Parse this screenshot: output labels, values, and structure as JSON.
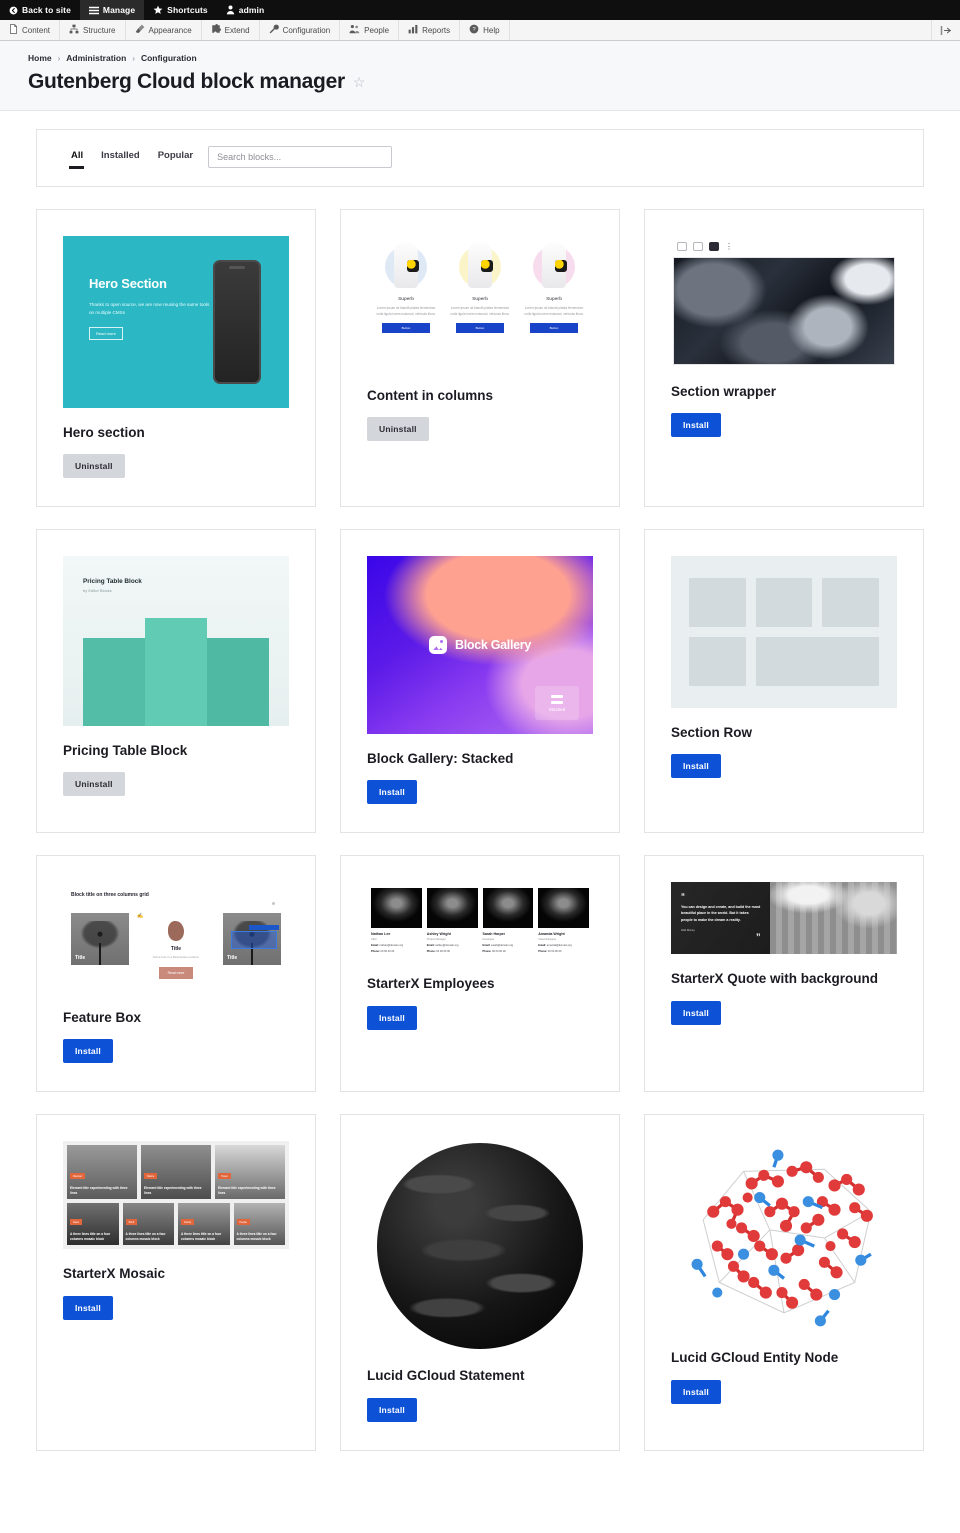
{
  "toolbar": {
    "back_to_site": "Back to site",
    "manage": "Manage",
    "shortcuts": "Shortcuts",
    "user": "admin",
    "menu": [
      {
        "label": "Content",
        "icon": "file-icon"
      },
      {
        "label": "Structure",
        "icon": "structure-icon"
      },
      {
        "label": "Appearance",
        "icon": "brush-icon"
      },
      {
        "label": "Extend",
        "icon": "puzzle-icon"
      },
      {
        "label": "Configuration",
        "icon": "wrench-icon"
      },
      {
        "label": "People",
        "icon": "people-icon"
      },
      {
        "label": "Reports",
        "icon": "bar-chart-icon"
      },
      {
        "label": "Help",
        "icon": "help-icon"
      }
    ]
  },
  "breadcrumb": {
    "items": [
      "Home",
      "Administration",
      "Configuration"
    ],
    "separator": "›"
  },
  "page": {
    "title": "Gutenberg Cloud block manager",
    "star": "☆"
  },
  "filter": {
    "tabs": [
      {
        "label": "All",
        "active": true
      },
      {
        "label": "Installed",
        "active": false
      },
      {
        "label": "Popular",
        "active": false
      }
    ],
    "search_placeholder": "Search blocks...",
    "search_value": ""
  },
  "colors": {
    "install_blue": "#0d52d6",
    "uninstall_gray": "#d3d6da",
    "page_bg": "#ffffff",
    "header_bg": "#f7f8fa",
    "toolbar_black": "#0f0f0f"
  },
  "cards": [
    {
      "title": "Hero section",
      "action": "Uninstall",
      "action_type": "uninstall",
      "thumb": "hero"
    },
    {
      "title": "Content in columns",
      "action": "Uninstall",
      "action_type": "uninstall",
      "thumb": "columns"
    },
    {
      "title": "Section wrapper",
      "action": "Install",
      "action_type": "install",
      "thumb": "wrapper"
    },
    {
      "title": "Pricing Table Block",
      "action": "Uninstall",
      "action_type": "uninstall",
      "thumb": "pricing"
    },
    {
      "title": "Block Gallery: Stacked",
      "action": "Install",
      "action_type": "install",
      "thumb": "gallery"
    },
    {
      "title": "Section Row",
      "action": "Install",
      "action_type": "install",
      "thumb": "row"
    },
    {
      "title": "Feature Box",
      "action": "Install",
      "action_type": "install",
      "thumb": "feature"
    },
    {
      "title": "StarterX Employees",
      "action": "Install",
      "action_type": "install",
      "thumb": "employees"
    },
    {
      "title": "StarterX Quote with background",
      "action": "Install",
      "action_type": "install",
      "thumb": "quote"
    },
    {
      "title": "StarterX Mosaic",
      "action": "Install",
      "action_type": "install",
      "thumb": "mosaic"
    },
    {
      "title": "Lucid GCloud Statement",
      "action": "Install",
      "action_type": "install",
      "thumb": "sphere"
    },
    {
      "title": "Lucid GCloud Entity Node",
      "action": "Install",
      "action_type": "install",
      "thumb": "molecule"
    }
  ],
  "thumbs": {
    "hero": {
      "heading": "Hero Section",
      "text": "Thanks to open source, we are now reusing the same tools on multiple CMSs",
      "button": "Read more"
    },
    "columns": {
      "items": [
        {
          "heading": "Superb",
          "text": "Lorem ipsum sit blandit platea fermentum nulla ligula lorem euismod, vehicula litora.",
          "button": "Button"
        },
        {
          "heading": "Superb",
          "text": "Lorem ipsum sit blandit platea fermentum nulla ligula lorem euismod, vehicula litora.",
          "button": "Button"
        },
        {
          "heading": "Superb",
          "text": "Lorem ipsum sit blandit platea fermentum nulla ligula lorem euismod, vehicula litora.",
          "button": "Button"
        }
      ]
    },
    "pricing": {
      "heading": "Pricing Table Block",
      "subtitle": "by Editor Blocks"
    },
    "gallery": {
      "logo_text": "Block Gallery",
      "badge": "Stacked"
    },
    "feature": {
      "heading": "Block title on three columns grid",
      "left_label": "Title",
      "mid_heading": "Title",
      "mid_text": "Some text in a Description content.",
      "mid_button": "Read more",
      "right_label": "Title",
      "tip_text": "Hi! I am a Description content. What's up?"
    },
    "employees": {
      "people": [
        {
          "name": "Nathan Lee",
          "role": "CEO",
          "email_label": "Email:",
          "email": "nathan@domain.org",
          "phone_label": "Phone:",
          "phone": "00 00 00 00"
        },
        {
          "name": "Ashley Wright",
          "role": "Project Manager",
          "email_label": "Email:",
          "email": "ashley@domain.org",
          "phone_label": "Phone:",
          "phone": "00 00 00 00"
        },
        {
          "name": "Sarah Harper",
          "role": "Developer",
          "email_label": "Email:",
          "email": "sarah@domain.org",
          "phone_label": "Phone:",
          "phone": "00 00 00 00"
        },
        {
          "name": "Amanda Wright",
          "role": "Visual Designer",
          "email_label": "Email:",
          "email": "amanda@domain.org",
          "phone_label": "Phone:",
          "phone": "00 00 00 00"
        }
      ]
    },
    "quote": {
      "mark_open": "“",
      "mark_close": "”",
      "text": "You can design and create, and build the most beautiful place in the world. But it takes people to make the dream a reality.",
      "author": "Walt Disney"
    },
    "mosaic": {
      "row1": [
        {
          "tag": "Discover",
          "caption": "Element title experimenting with three lines"
        },
        {
          "tag": "Nature",
          "caption": "Element title experimenting with three lines"
        },
        {
          "tag": "Travel",
          "caption": "Element title experimenting with three lines"
        }
      ],
      "row2": [
        {
          "tag": "News",
          "caption": "A three lines title on a four columns mosaic block"
        },
        {
          "tag": "Work",
          "caption": "A three lines title on a four columns mosaic block"
        },
        {
          "tag": "Family",
          "caption": "A three lines title on a four columns mosaic block"
        },
        {
          "tag": "People",
          "caption": "A three lines title on a four columns mosaic block"
        }
      ]
    }
  }
}
